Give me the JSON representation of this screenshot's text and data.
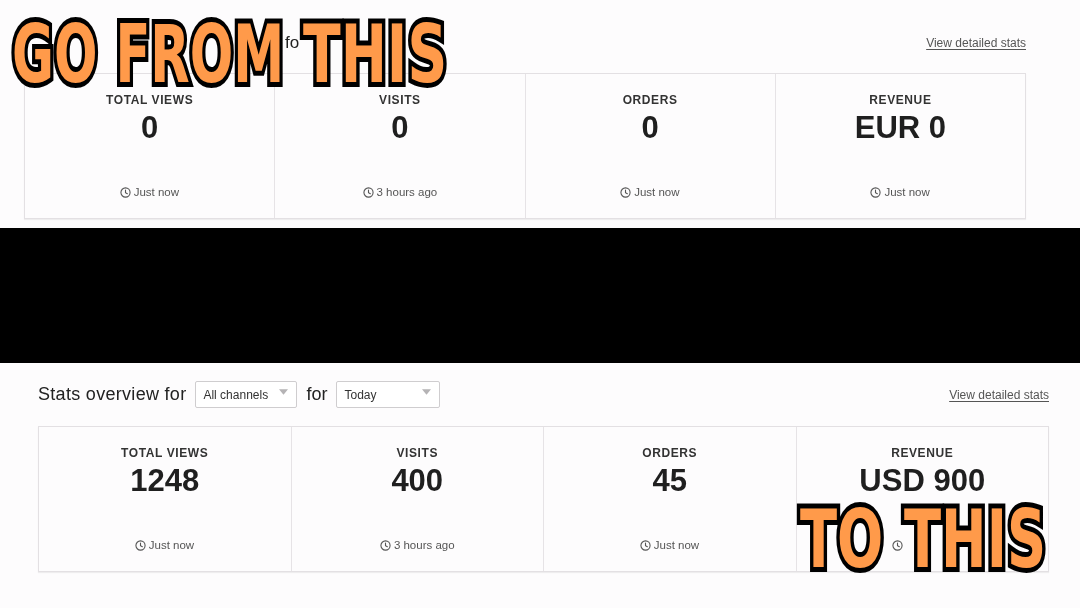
{
  "panels": [
    {
      "kind": "before",
      "header": {
        "title_fragment": "fo"
      },
      "link": "View detailed stats",
      "stats": [
        {
          "label": "TOTAL VIEWS",
          "value": "0",
          "time": "Just now"
        },
        {
          "label": "VISITS",
          "value": "0",
          "time": "3 hours ago"
        },
        {
          "label": "ORDERS",
          "value": "0",
          "time": "Just now"
        },
        {
          "label": "REVENUE",
          "value": "EUR 0",
          "time": "Just now"
        }
      ],
      "caption": [
        "GO FROM",
        "THIS"
      ]
    },
    {
      "kind": "after",
      "header": {
        "title": "Stats overview for",
        "channel_select": "All channels",
        "connector": "for",
        "period_select": "Today"
      },
      "link": "View detailed stats",
      "stats": [
        {
          "label": "TOTAL VIEWS",
          "value": "1248",
          "time": "Just now"
        },
        {
          "label": "VISITS",
          "value": "400",
          "time": "3 hours ago"
        },
        {
          "label": "ORDERS",
          "value": "45",
          "time": "Just now"
        },
        {
          "label": "REVENUE",
          "value": "USD 900"
        }
      ],
      "caption": [
        "TO",
        "THIS"
      ]
    }
  ]
}
